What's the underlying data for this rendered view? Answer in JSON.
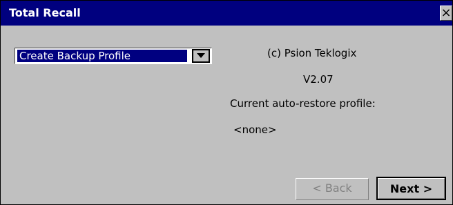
{
  "window": {
    "title": "Total Recall",
    "close_label": "×"
  },
  "profile_select": {
    "selected": "Create Backup Profile",
    "arrow_icon": "chevron-down-icon"
  },
  "info": {
    "copyright": "(c) Psion Teklogix",
    "version": "V2.07",
    "current_profile_label": "Current auto-restore profile:",
    "current_profile_value": "<none>"
  },
  "buttons": {
    "back": "< Back",
    "next": "Next >"
  },
  "colors": {
    "titlebar": "#00007f",
    "face": "#c0c0c0",
    "selection": "#000080",
    "disabled_text": "#808080"
  }
}
